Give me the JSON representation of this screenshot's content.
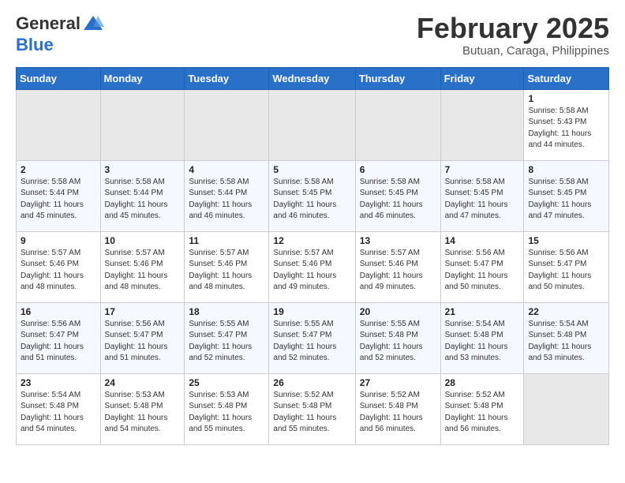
{
  "header": {
    "logo_general": "General",
    "logo_blue": "Blue",
    "month_title": "February 2025",
    "location": "Butuan, Caraga, Philippines"
  },
  "weekdays": [
    "Sunday",
    "Monday",
    "Tuesday",
    "Wednesday",
    "Thursday",
    "Friday",
    "Saturday"
  ],
  "weeks": [
    [
      {
        "day": "",
        "info": ""
      },
      {
        "day": "",
        "info": ""
      },
      {
        "day": "",
        "info": ""
      },
      {
        "day": "",
        "info": ""
      },
      {
        "day": "",
        "info": ""
      },
      {
        "day": "",
        "info": ""
      },
      {
        "day": "1",
        "info": "Sunrise: 5:58 AM\nSunset: 5:43 PM\nDaylight: 11 hours\nand 44 minutes."
      }
    ],
    [
      {
        "day": "2",
        "info": "Sunrise: 5:58 AM\nSunset: 5:44 PM\nDaylight: 11 hours\nand 45 minutes."
      },
      {
        "day": "3",
        "info": "Sunrise: 5:58 AM\nSunset: 5:44 PM\nDaylight: 11 hours\nand 45 minutes."
      },
      {
        "day": "4",
        "info": "Sunrise: 5:58 AM\nSunset: 5:44 PM\nDaylight: 11 hours\nand 46 minutes."
      },
      {
        "day": "5",
        "info": "Sunrise: 5:58 AM\nSunset: 5:45 PM\nDaylight: 11 hours\nand 46 minutes."
      },
      {
        "day": "6",
        "info": "Sunrise: 5:58 AM\nSunset: 5:45 PM\nDaylight: 11 hours\nand 46 minutes."
      },
      {
        "day": "7",
        "info": "Sunrise: 5:58 AM\nSunset: 5:45 PM\nDaylight: 11 hours\nand 47 minutes."
      },
      {
        "day": "8",
        "info": "Sunrise: 5:58 AM\nSunset: 5:45 PM\nDaylight: 11 hours\nand 47 minutes."
      }
    ],
    [
      {
        "day": "9",
        "info": "Sunrise: 5:57 AM\nSunset: 5:46 PM\nDaylight: 11 hours\nand 48 minutes."
      },
      {
        "day": "10",
        "info": "Sunrise: 5:57 AM\nSunset: 5:46 PM\nDaylight: 11 hours\nand 48 minutes."
      },
      {
        "day": "11",
        "info": "Sunrise: 5:57 AM\nSunset: 5:46 PM\nDaylight: 11 hours\nand 48 minutes."
      },
      {
        "day": "12",
        "info": "Sunrise: 5:57 AM\nSunset: 5:46 PM\nDaylight: 11 hours\nand 49 minutes."
      },
      {
        "day": "13",
        "info": "Sunrise: 5:57 AM\nSunset: 5:46 PM\nDaylight: 11 hours\nand 49 minutes."
      },
      {
        "day": "14",
        "info": "Sunrise: 5:56 AM\nSunset: 5:47 PM\nDaylight: 11 hours\nand 50 minutes."
      },
      {
        "day": "15",
        "info": "Sunrise: 5:56 AM\nSunset: 5:47 PM\nDaylight: 11 hours\nand 50 minutes."
      }
    ],
    [
      {
        "day": "16",
        "info": "Sunrise: 5:56 AM\nSunset: 5:47 PM\nDaylight: 11 hours\nand 51 minutes."
      },
      {
        "day": "17",
        "info": "Sunrise: 5:56 AM\nSunset: 5:47 PM\nDaylight: 11 hours\nand 51 minutes."
      },
      {
        "day": "18",
        "info": "Sunrise: 5:55 AM\nSunset: 5:47 PM\nDaylight: 11 hours\nand 52 minutes."
      },
      {
        "day": "19",
        "info": "Sunrise: 5:55 AM\nSunset: 5:47 PM\nDaylight: 11 hours\nand 52 minutes."
      },
      {
        "day": "20",
        "info": "Sunrise: 5:55 AM\nSunset: 5:48 PM\nDaylight: 11 hours\nand 52 minutes."
      },
      {
        "day": "21",
        "info": "Sunrise: 5:54 AM\nSunset: 5:48 PM\nDaylight: 11 hours\nand 53 minutes."
      },
      {
        "day": "22",
        "info": "Sunrise: 5:54 AM\nSunset: 5:48 PM\nDaylight: 11 hours\nand 53 minutes."
      }
    ],
    [
      {
        "day": "23",
        "info": "Sunrise: 5:54 AM\nSunset: 5:48 PM\nDaylight: 11 hours\nand 54 minutes."
      },
      {
        "day": "24",
        "info": "Sunrise: 5:53 AM\nSunset: 5:48 PM\nDaylight: 11 hours\nand 54 minutes."
      },
      {
        "day": "25",
        "info": "Sunrise: 5:53 AM\nSunset: 5:48 PM\nDaylight: 11 hours\nand 55 minutes."
      },
      {
        "day": "26",
        "info": "Sunrise: 5:52 AM\nSunset: 5:48 PM\nDaylight: 11 hours\nand 55 minutes."
      },
      {
        "day": "27",
        "info": "Sunrise: 5:52 AM\nSunset: 5:48 PM\nDaylight: 11 hours\nand 56 minutes."
      },
      {
        "day": "28",
        "info": "Sunrise: 5:52 AM\nSunset: 5:48 PM\nDaylight: 11 hours\nand 56 minutes."
      },
      {
        "day": "",
        "info": ""
      }
    ]
  ]
}
